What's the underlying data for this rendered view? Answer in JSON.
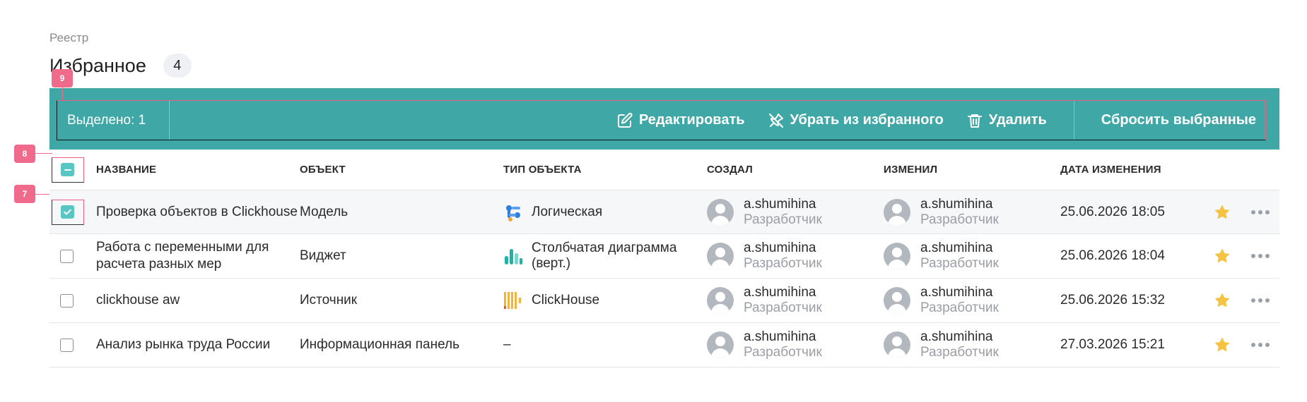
{
  "breadcrumb": "Реестр",
  "title": "Избранное",
  "count": "4",
  "selection_bar": {
    "selected_text": "Выделено: 1",
    "edit_label": "Редактировать",
    "unfavorite_label": "Убрать из избранного",
    "delete_label": "Удалить",
    "reset_label": "Сбросить выбранные"
  },
  "markers": {
    "m9": "9",
    "m8": "8",
    "m7": "7"
  },
  "columns": {
    "name": "НАЗВАНИЕ",
    "object": "ОБЪЕКТ",
    "type": "ТИП ОБЪЕКТА",
    "created": "СОЗДАЛ",
    "changed": "ИЗМЕНИЛ",
    "date": "ДАТА ИЗМЕНЕНИЯ"
  },
  "rows": [
    {
      "name": "Проверка объектов в Clickhouse",
      "object": "Модель",
      "type": "Логическая",
      "type_icon": "logical-model-icon",
      "creator": "a.shumihina",
      "creator_role": "Разработчик",
      "editor": "a.shumihina",
      "editor_role": "Разработчик",
      "date": "25.06.2026 18:05",
      "checked": true
    },
    {
      "name": "Работа с переменными для расчета разных мер",
      "object": "Виджет",
      "type": "Столбчатая диаграмма (верт.)",
      "type_icon": "bar-chart-icon",
      "creator": "a.shumihina",
      "creator_role": "Разработчик",
      "editor": "a.shumihina",
      "editor_role": "Разработчик",
      "date": "25.06.2026 18:04",
      "checked": false
    },
    {
      "name": "clickhouse aw",
      "object": "Источник",
      "type": "ClickHouse",
      "type_icon": "clickhouse-icon",
      "creator": "a.shumihina",
      "creator_role": "Разработчик",
      "editor": "a.shumihina",
      "editor_role": "Разработчик",
      "date": "25.06.2026 15:32",
      "checked": false
    },
    {
      "name": "Анализ рынка труда России",
      "object": "Информационная панель",
      "type": "–",
      "type_icon": "",
      "creator": "a.shumihina",
      "creator_role": "Разработчик",
      "editor": "a.shumihina",
      "editor_role": "Разработчик",
      "date": "27.03.2026 15:21",
      "checked": false
    }
  ],
  "colors": {
    "accent": "#3fa8a6",
    "checkbox": "#5ac6c4",
    "star": "#f5c242",
    "marker": "#f06a8c"
  }
}
